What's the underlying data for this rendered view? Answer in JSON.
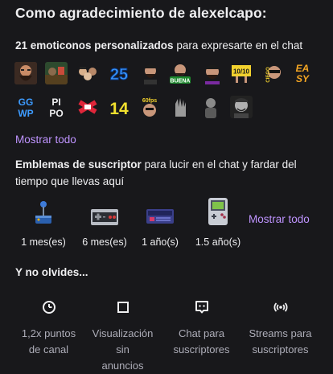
{
  "title": "Como agradecimiento de alexelcapo:",
  "emotes": {
    "count_label": "21 emoticonos personalizados",
    "rest_label": " para expresarte en el chat",
    "show_all": "Mostrar todo",
    "items": [
      {
        "name": "emote-bearded-face"
      },
      {
        "name": "emote-landscape"
      },
      {
        "name": "emote-group"
      },
      {
        "name": "emote-25",
        "text": "25"
      },
      {
        "name": "emote-man-beard"
      },
      {
        "name": "emote-buena",
        "text": "BUENA"
      },
      {
        "name": "emote-man-closeup"
      },
      {
        "name": "emote-10-10",
        "text": "10/10"
      },
      {
        "name": "emote-ciego",
        "text": "CIEGO"
      },
      {
        "name": "emote-easy",
        "text": "EA SY"
      },
      {
        "name": "emote-ggwp",
        "text": "GG WP"
      },
      {
        "name": "emote-pipo",
        "text": "PI PO"
      },
      {
        "name": "emote-red-cross"
      },
      {
        "name": "emote-14",
        "text": "14"
      },
      {
        "name": "emote-fps-face",
        "text": "60 fps"
      },
      {
        "name": "emote-hand"
      },
      {
        "name": "emote-sitting-man"
      },
      {
        "name": "emote-smiling-man"
      }
    ]
  },
  "badges": {
    "bold_label": "Emblemas de suscriptor",
    "rest_label": " para lucir en el chat y fardar del tiempo que llevas aquí",
    "show_all": "Mostrar todo",
    "items": [
      {
        "label": "1 mes(es)",
        "icon": "joystick-icon"
      },
      {
        "label": "6 mes(es)",
        "icon": "nes-controller-icon"
      },
      {
        "label": "1 año(s)",
        "icon": "console-icon"
      },
      {
        "label": "1.5 año(s)",
        "icon": "gameboy-icon"
      }
    ]
  },
  "perks": {
    "title": "Y no olvides...",
    "items": [
      {
        "line1": "1,2x puntos",
        "line2": "de canal",
        "icon": "channel-points-icon"
      },
      {
        "line1": "Visualización sin",
        "line2": "anuncios",
        "icon": "ad-free-icon"
      },
      {
        "line1": "Chat para",
        "line2": "suscriptores",
        "icon": "sub-chat-icon"
      },
      {
        "line1": "Streams para",
        "line2": "suscriptores",
        "icon": "sub-streams-icon"
      }
    ]
  },
  "colors": {
    "background": "#18181b",
    "text": "#efeff1",
    "muted": "#adadb8",
    "accent": "#bf94ff"
  }
}
